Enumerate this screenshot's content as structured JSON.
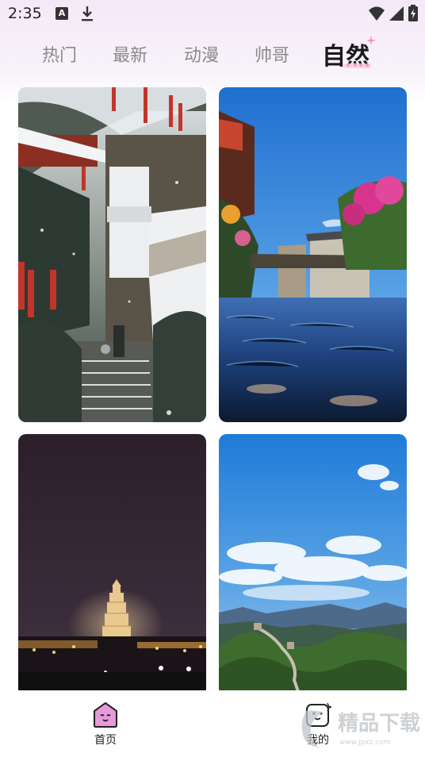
{
  "status_bar": {
    "time": "2:35",
    "notification_icon_letter": "A",
    "icons": [
      "a-notification-icon",
      "download-icon",
      "wifi-icon",
      "cellular-icon",
      "battery-charging-icon"
    ]
  },
  "tabs": [
    {
      "label": "热门",
      "active": false
    },
    {
      "label": "最新",
      "active": false
    },
    {
      "label": "动漫",
      "active": false
    },
    {
      "label": "帅哥",
      "active": false
    },
    {
      "label": "自然",
      "active": true
    }
  ],
  "wallpapers": [
    {
      "name": "snowy-temple-stairs"
    },
    {
      "name": "village-canal-flowers"
    },
    {
      "name": "night-pagoda"
    },
    {
      "name": "great-wall-blue-sky"
    }
  ],
  "bottom_nav": {
    "home_label": "首页",
    "mine_label": "我的"
  },
  "watermark": {
    "text": "精品下载",
    "url": "www.jpxz.com"
  },
  "colors": {
    "active_tab": "#1a1a1a",
    "inactive_tab": "#8a8a8a",
    "accent_pink": "#ff8fb8",
    "home_icon": "#e07fd0"
  }
}
